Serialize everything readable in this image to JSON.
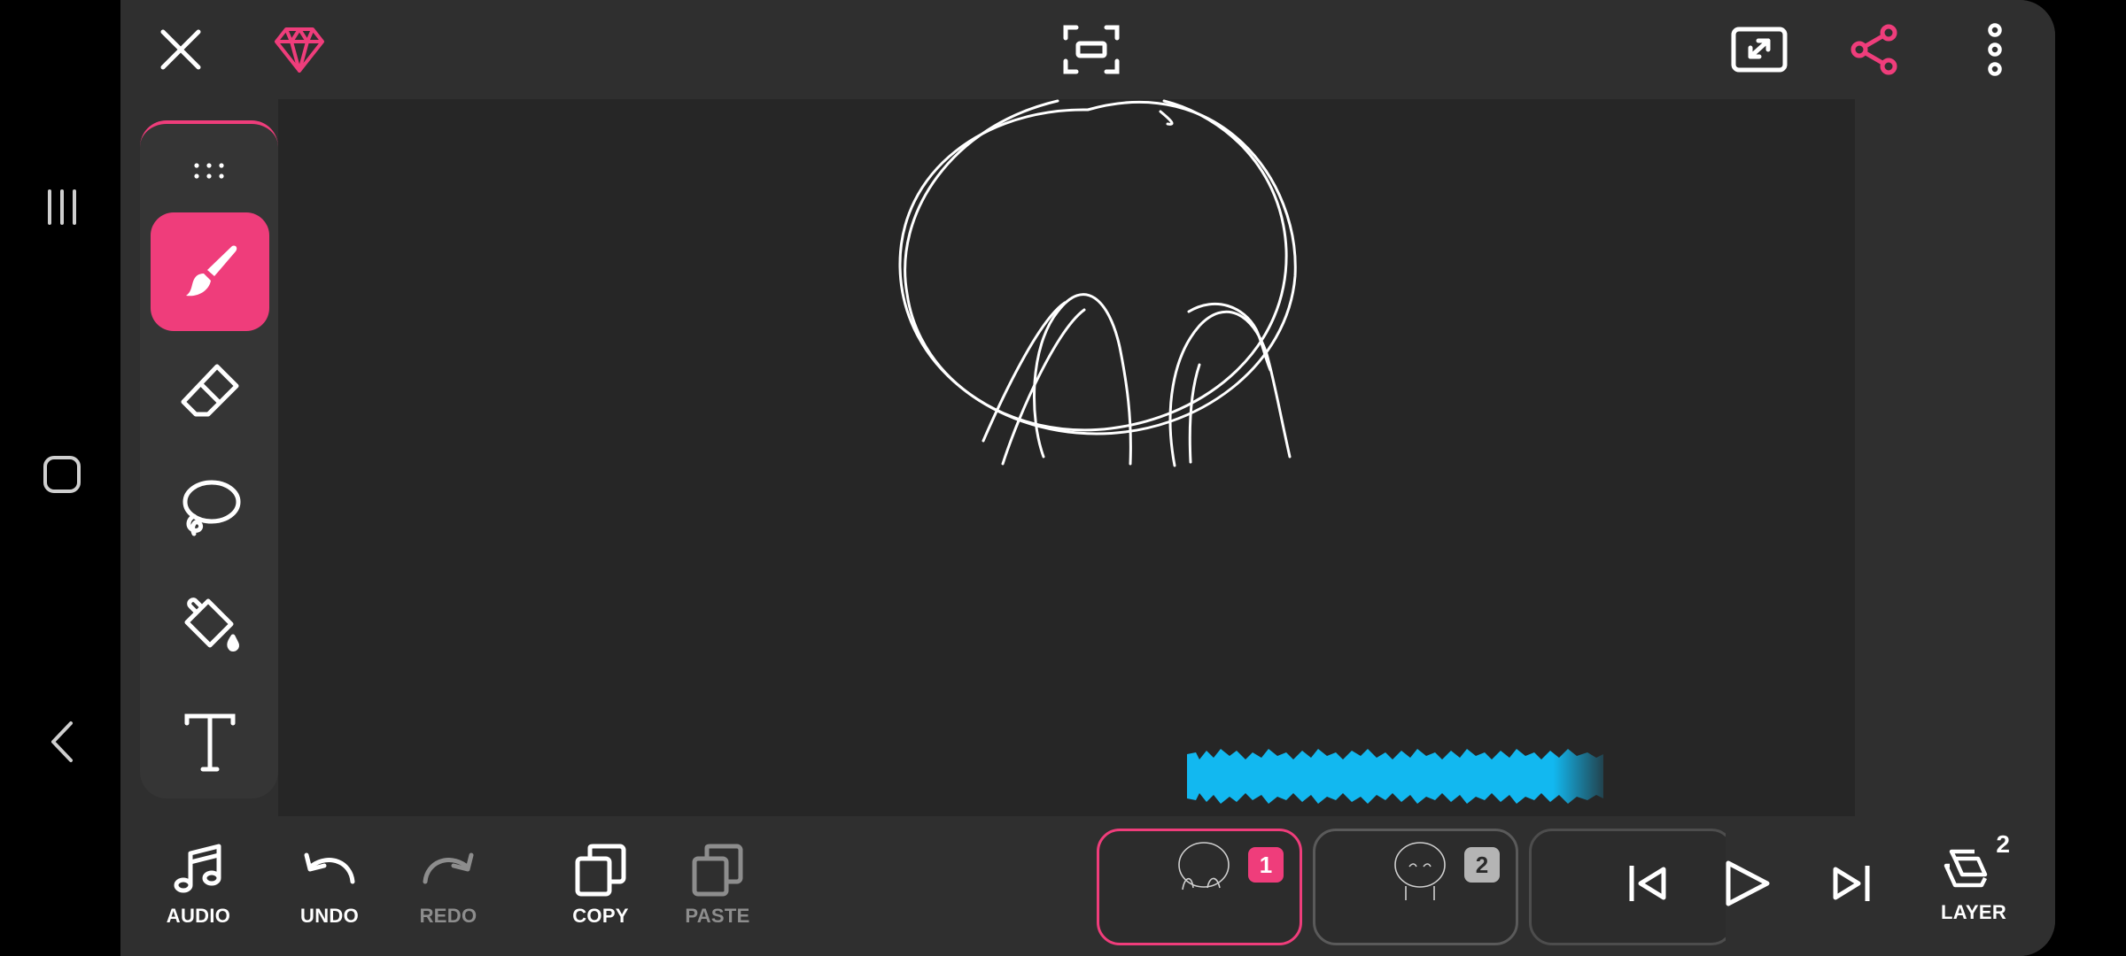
{
  "colors": {
    "accent": "#ef3d7b",
    "audio_waveform": "#12b8f0",
    "canvas_bg": "#262626",
    "toolbar_bg": "#2f2f2f"
  },
  "topbar": {
    "icons": [
      "close-icon",
      "premium-gem-icon",
      "fit-to-screen-icon",
      "fullscreen-icon",
      "share-icon",
      "more-options-icon"
    ]
  },
  "tools": {
    "handle_icon": "drag-handle-icon",
    "items": [
      {
        "name": "brush-icon",
        "active": true
      },
      {
        "name": "eraser-icon",
        "active": false
      },
      {
        "name": "lasso-icon",
        "active": false
      },
      {
        "name": "fill-bucket-icon",
        "active": false
      },
      {
        "name": "text-tool-icon",
        "active": false
      }
    ]
  },
  "actions": {
    "audio": "AUDIO",
    "undo": "UNDO",
    "redo": "REDO",
    "copy": "COPY",
    "paste": "PASTE",
    "layer": "LAYER",
    "layer_count": "2"
  },
  "frames": [
    {
      "number": "1",
      "selected": true
    },
    {
      "number": "2",
      "selected": false
    }
  ],
  "playback": {
    "icons": [
      "skip-to-start-icon",
      "play-icon",
      "skip-to-end-icon"
    ]
  }
}
